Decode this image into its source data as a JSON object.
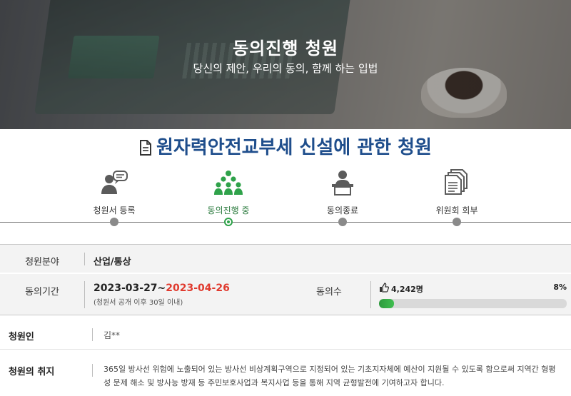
{
  "hero": {
    "title": "동의진행 청원",
    "subtitle": "당신의 제안, 우리의 동의, 함께 하는 입법"
  },
  "petition": {
    "title": "원자력안전교부세 신설에 관한 청원"
  },
  "steps": [
    {
      "label": "청원서 등록",
      "icon": "speech-person-icon",
      "active": false
    },
    {
      "label": "동의진행 중",
      "icon": "group-people-icon",
      "active": true
    },
    {
      "label": "동의종료",
      "icon": "podium-speaker-icon",
      "active": false
    },
    {
      "label": "위원회 회부",
      "icon": "document-stack-icon",
      "active": false
    }
  ],
  "info": {
    "field_label": "청원분야",
    "field_value": "산업/통상",
    "period_label": "동의기간",
    "period_start": "2023-03-27~",
    "period_end": "2023-04-26",
    "period_note": "(청원서 공개 이후 30일 이내)",
    "agree_label": "동의수",
    "agree_count": "4,242명",
    "agree_percent": "8%",
    "agree_fraction": 0.08,
    "petitioner_label": "청원인",
    "petitioner_value": "김**",
    "purpose_label": "청원의 취지",
    "purpose_text": "365일 방사선 위험에 노출되어 있는 방사선 비상계획구역으로 지정되어 있는 기초지자체에 예산이 지원될 수 있도록 함으로써 지역간 형평성 문제 해소 및 방사능 방재 등 주민보호사업과 복지사업 등을 통해 지역 균형발전에 기여하고자 합니다."
  },
  "colors": {
    "title_blue": "#1f4e8c",
    "active_green": "#2fa24a",
    "end_date_red": "#e03b2f"
  }
}
